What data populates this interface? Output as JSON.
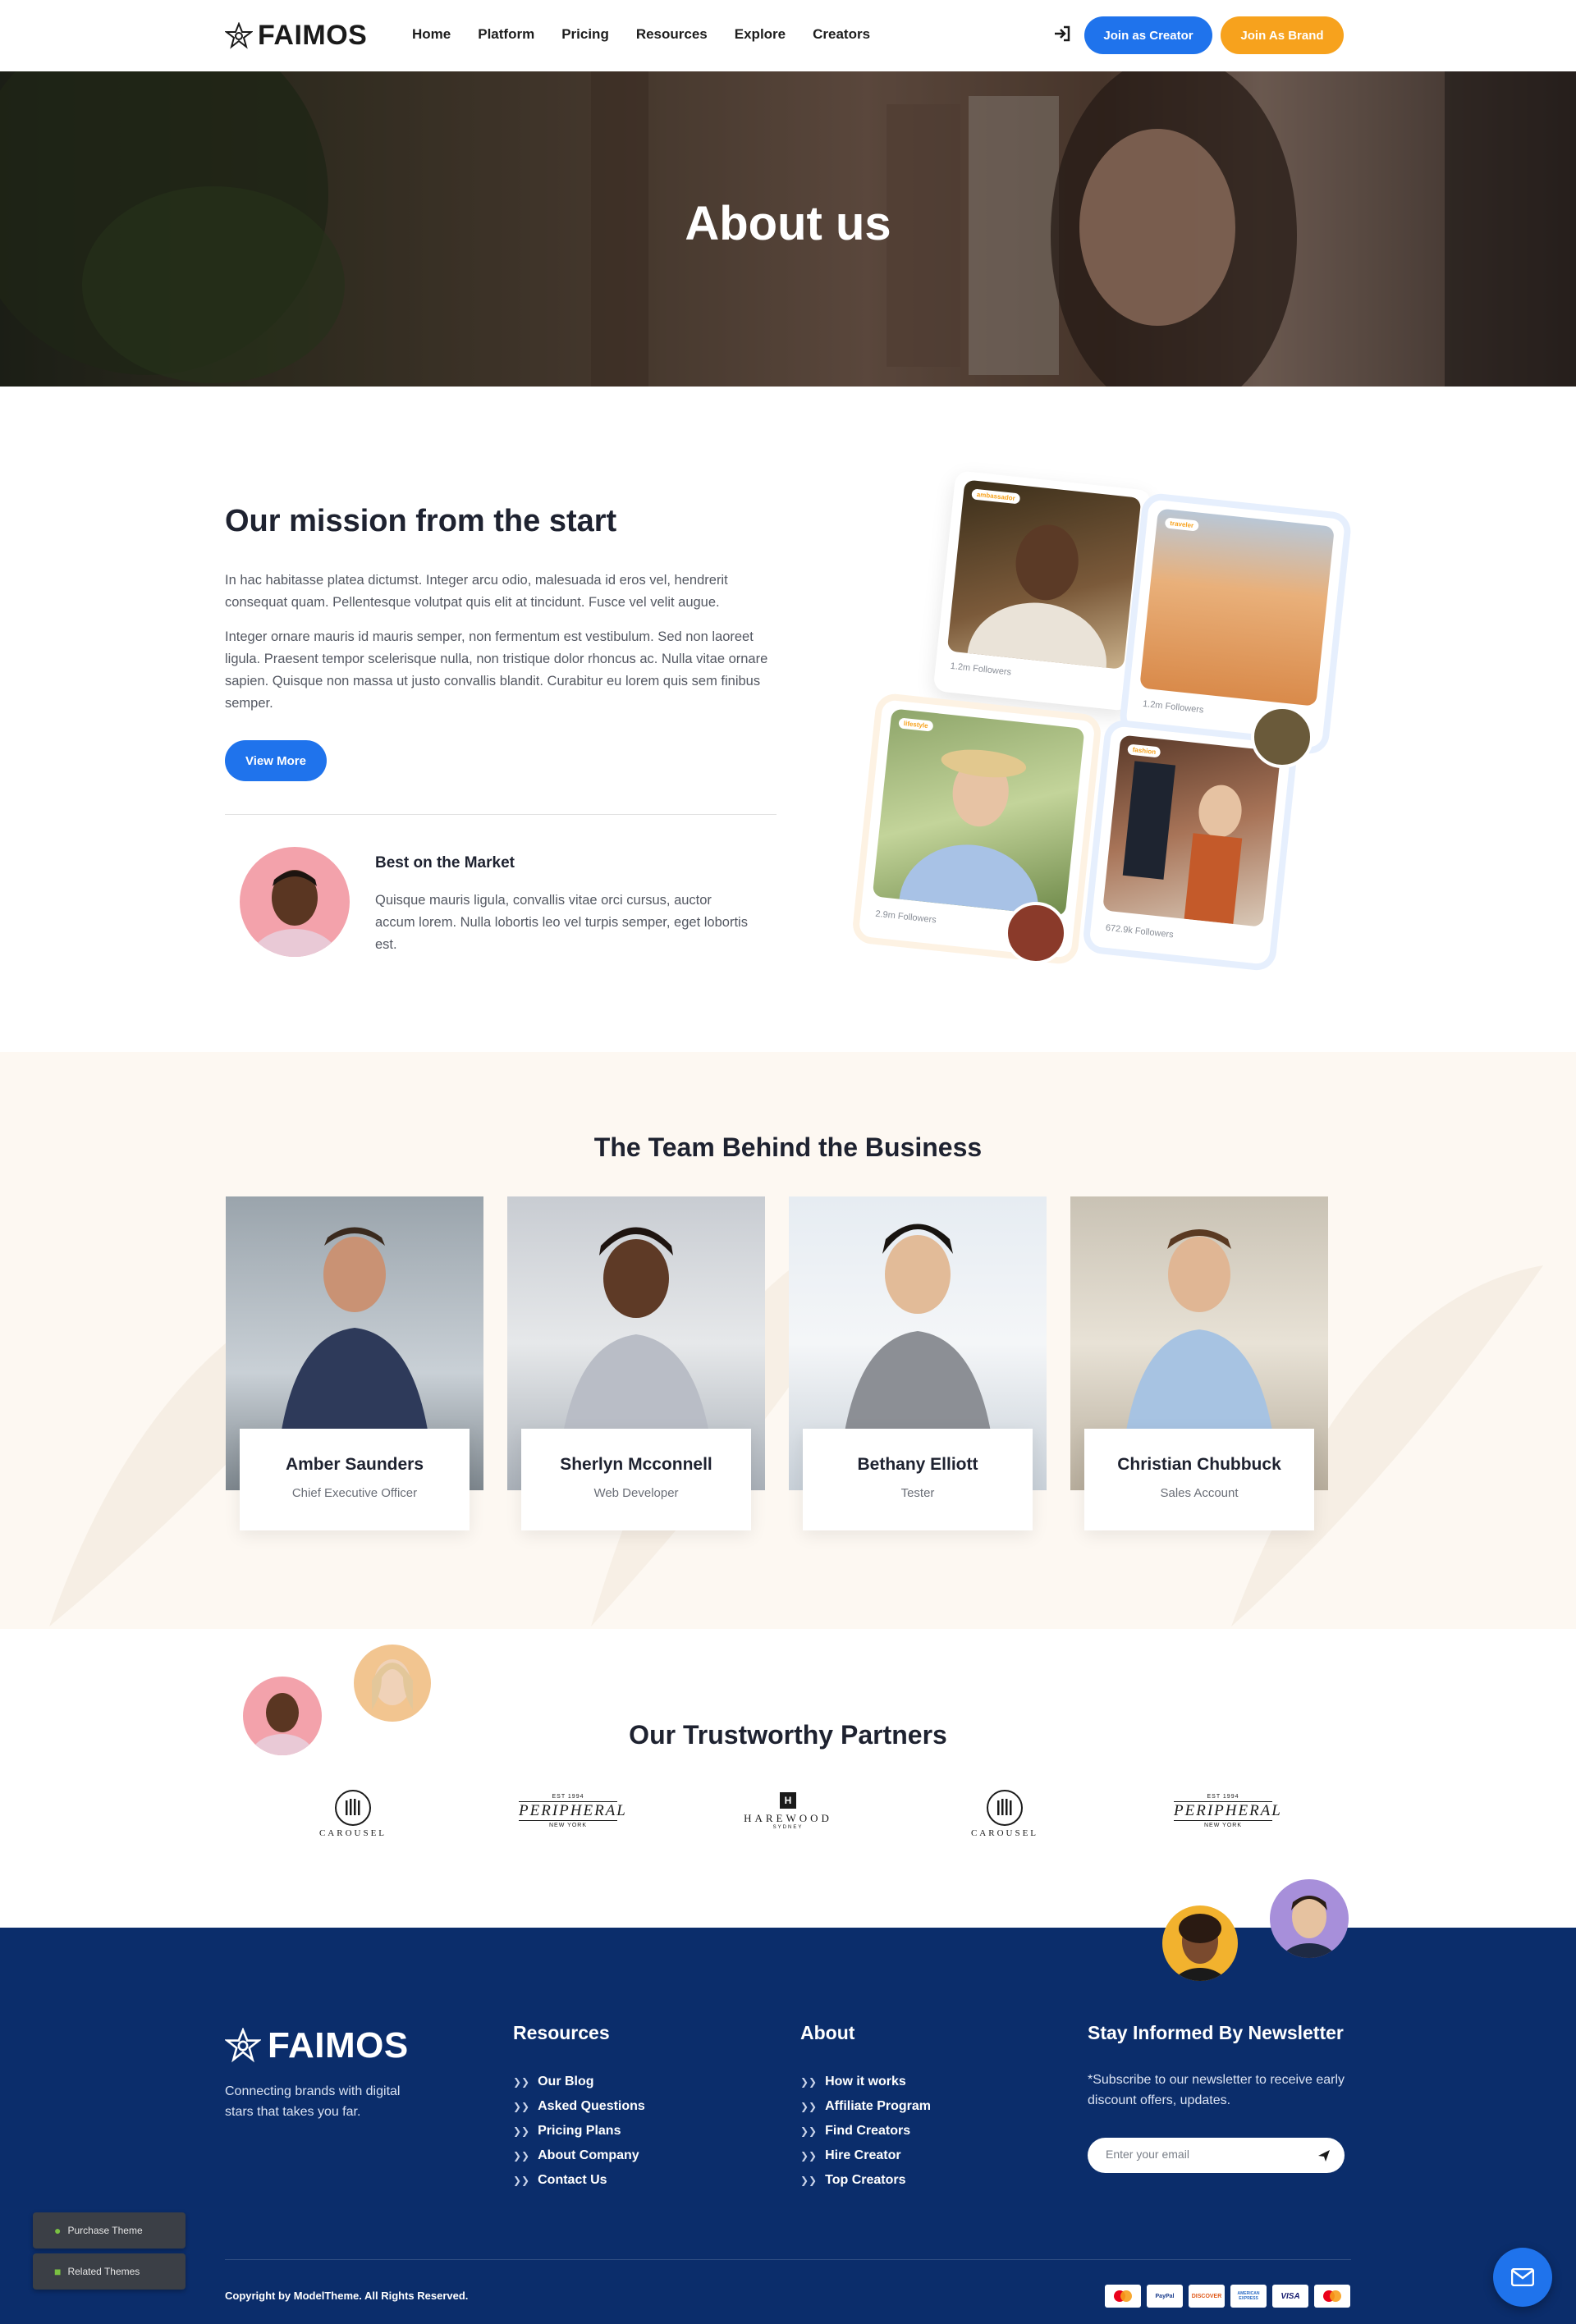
{
  "header": {
    "logo_text": "FAIMOS",
    "nav": [
      "Home",
      "Platform",
      "Pricing",
      "Resources",
      "Explore",
      "Creators"
    ],
    "join_creator": "Join as Creator",
    "join_brand": "Join As Brand"
  },
  "hero": {
    "title": "About us"
  },
  "mission": {
    "title": "Our mission from the start",
    "para1": "In hac habitasse platea dictumst. Integer arcu odio, malesuada id eros vel, hendrerit consequat quam. Pellentesque volutpat quis elit at tincidunt. Fusce vel velit augue.",
    "para2": "Integer ornare mauris id mauris semper, non fermentum est vestibulum. Sed non laoreet ligula. Praesent tempor scelerisque nulla, non tristique dolor rhoncus ac. Nulla vitae ornare sapien. Quisque non massa ut justo convallis blandit. Curabitur eu lorem quis sem finibus semper.",
    "button": "View More",
    "best_title": "Best on the Market",
    "best_text": "Quisque mauris ligula, convallis vitae orci cursus, auctor accum lorem. Nulla lobortis leo vel turpis semper, eget lobortis est."
  },
  "creators": [
    {
      "followers": "1.2m Followers"
    },
    {
      "followers": "1.2m Followers"
    },
    {
      "followers": "2.9m Followers"
    },
    {
      "followers": "672.9k Followers"
    }
  ],
  "team": {
    "title": "The Team Behind the Business",
    "members": [
      {
        "name": "Amber Saunders",
        "role": "Chief Executive Officer"
      },
      {
        "name": "Sherlyn Mcconnell",
        "role": "Web Developer"
      },
      {
        "name": "Bethany Elliott",
        "role": "Tester"
      },
      {
        "name": "Christian Chubbuck",
        "role": "Sales Account"
      }
    ]
  },
  "partners": {
    "title": "Our Trustworthy Partners",
    "logos": [
      {
        "name": "CAROUSEL"
      },
      {
        "name": "PERIPHERAL",
        "top": "EST 1994",
        "bottom": "NEW YORK"
      },
      {
        "name": "HAREWOOD",
        "top": "H",
        "bottom": "SYDNEY"
      },
      {
        "name": "CAROUSEL"
      },
      {
        "name": "PERIPHERAL",
        "top": "EST 1994",
        "bottom": "NEW YORK"
      }
    ]
  },
  "footer": {
    "logo_text": "FAIMOS",
    "description": "Connecting brands with digital stars that takes you far.",
    "resources_title": "Resources",
    "resources": [
      "Our Blog",
      "Asked Questions",
      "Pricing Plans",
      "About Company",
      "Contact Us"
    ],
    "about_title": "About",
    "about": [
      "How it works",
      "Affiliate Program",
      "Find Creators",
      "Hire Creator",
      "Top Creators"
    ],
    "newsletter_title": "Stay Informed By Newsletter",
    "newsletter_text": "*Subscribe to our newsletter to receive early discount offers, updates.",
    "email_placeholder": "Enter your email",
    "copyright": "Copyright by ModelTheme. All Rights Reserved.",
    "payments": [
      "mastercard",
      "PayPal",
      "DISCOVER",
      "AMERICAN EXPRESS",
      "VISA",
      "mastercard"
    ]
  },
  "widgets": {
    "purchase": "Purchase Theme",
    "related": "Related Themes"
  },
  "colors": {
    "primary": "#1f73ec",
    "accent": "#f7a21d",
    "footer": "#0b2d6b"
  }
}
